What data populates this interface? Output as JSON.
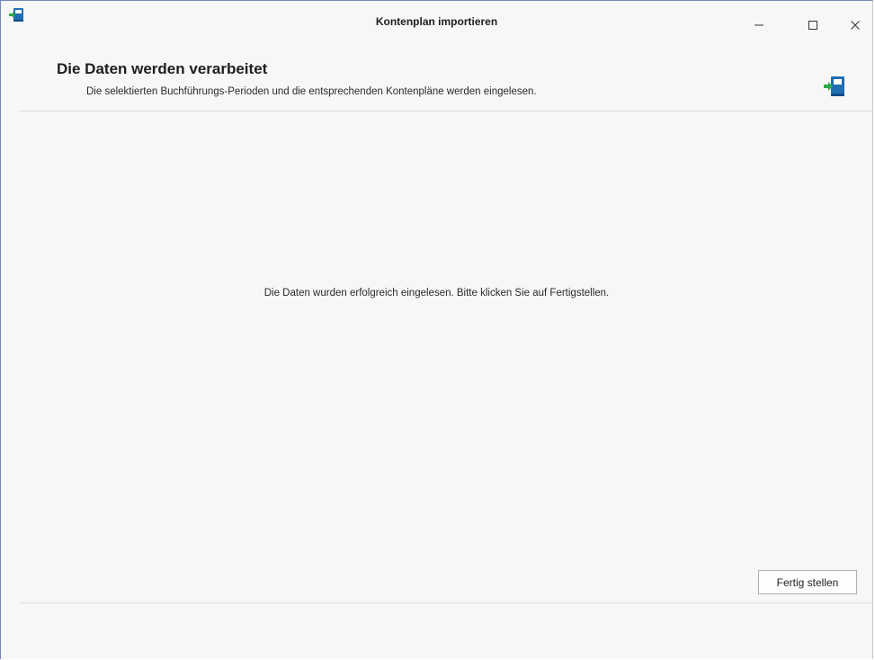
{
  "window": {
    "title": "Kontenplan importieren",
    "controls": {
      "minimize": "minimize-icon",
      "maximize": "maximize-icon",
      "close": "close-icon"
    },
    "app_icon": "book-import-icon"
  },
  "header": {
    "title": "Die Daten werden verarbeitet",
    "subtitle": "Die selektierten Buchführungs-Perioden und die entsprechenden Kontenpläne werden eingelesen.",
    "icon": "book-import-icon"
  },
  "body": {
    "message": "Die Daten wurden erfolgreich eingelesen. Bitte klicken Sie auf Fertigstellen."
  },
  "footer": {
    "finish_label": "Fertig stellen"
  },
  "colors": {
    "icon_green": "#2eaa4a",
    "icon_blue": "#1f6fb2",
    "window_bg": "#f7f7f7",
    "divider": "#dcdcdc"
  }
}
